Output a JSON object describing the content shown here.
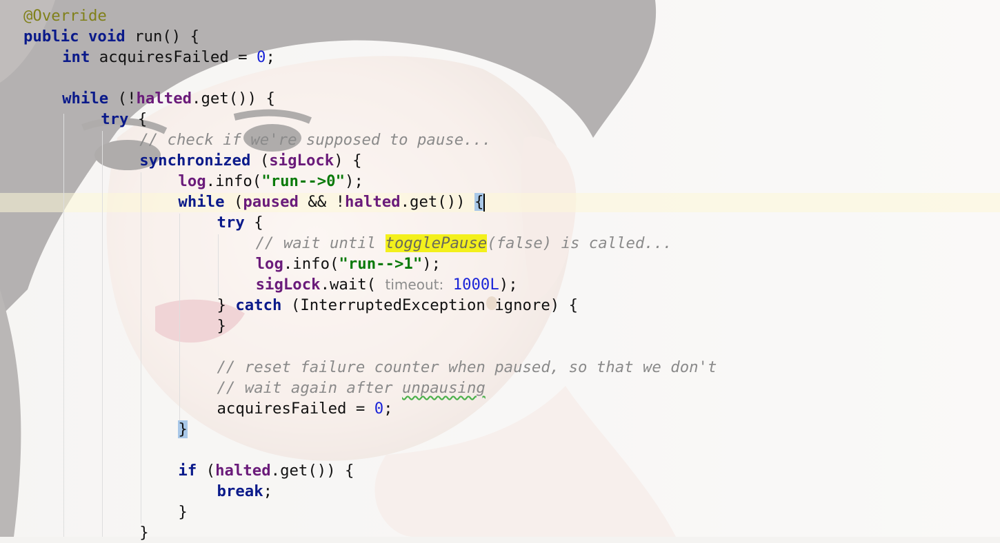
{
  "editor": {
    "lines": [
      {
        "indent": 0,
        "tokens": [
          {
            "t": "@Override",
            "c": "ann"
          }
        ]
      },
      {
        "indent": 0,
        "tokens": [
          {
            "t": "public",
            "c": "kw"
          },
          {
            "t": " "
          },
          {
            "t": "void",
            "c": "kw"
          },
          {
            "t": " run() {"
          }
        ]
      },
      {
        "indent": 1,
        "tokens": [
          {
            "t": "int",
            "c": "kw"
          },
          {
            "t": " acquiresFailed = "
          },
          {
            "t": "0",
            "c": "num"
          },
          {
            "t": ";"
          }
        ]
      },
      {
        "indent": 0,
        "tokens": []
      },
      {
        "indent": 1,
        "tokens": [
          {
            "t": "while",
            "c": "kw"
          },
          {
            "t": " (!"
          },
          {
            "t": "halted",
            "c": "fld"
          },
          {
            "t": ".get()) {"
          }
        ]
      },
      {
        "indent": 2,
        "tokens": [
          {
            "t": "try",
            "c": "kw"
          },
          {
            "t": " {"
          }
        ]
      },
      {
        "indent": 3,
        "tokens": [
          {
            "t": "// check if we're supposed to pause...",
            "c": "com"
          }
        ]
      },
      {
        "indent": 3,
        "tokens": [
          {
            "t": "synchronized",
            "c": "kw"
          },
          {
            "t": " ("
          },
          {
            "t": "sigLock",
            "c": "fld"
          },
          {
            "t": ") {"
          }
        ]
      },
      {
        "indent": 4,
        "tokens": [
          {
            "t": "log",
            "c": "fld"
          },
          {
            "t": ".info("
          },
          {
            "t": "\"run-->0\"",
            "c": "str"
          },
          {
            "t": ");"
          }
        ]
      },
      {
        "indent": 4,
        "tokens": [
          {
            "t": "while",
            "c": "kw"
          },
          {
            "t": " ("
          },
          {
            "t": "paused",
            "c": "fld"
          },
          {
            "t": " && !"
          },
          {
            "t": "halted",
            "c": "fld"
          },
          {
            "t": ".get()) "
          },
          {
            "t": "{",
            "c": "brace-hl"
          },
          {
            "t": "",
            "c": "caret"
          }
        ]
      },
      {
        "indent": 5,
        "tokens": [
          {
            "t": "try",
            "c": "kw"
          },
          {
            "t": " {"
          }
        ]
      },
      {
        "indent": 6,
        "tokens": [
          {
            "t": "// wait until ",
            "c": "com"
          },
          {
            "t": "togglePause",
            "c": "hl"
          },
          {
            "t": "(false) is called...",
            "c": "com"
          }
        ]
      },
      {
        "indent": 6,
        "tokens": [
          {
            "t": "log",
            "c": "fld"
          },
          {
            "t": ".info("
          },
          {
            "t": "\"run-->1\"",
            "c": "str"
          },
          {
            "t": ");"
          }
        ]
      },
      {
        "indent": 6,
        "tokens": [
          {
            "t": "sigLock",
            "c": "fld"
          },
          {
            "t": ".wait( "
          },
          {
            "t": "timeout:",
            "c": "hint"
          },
          {
            "t": " "
          },
          {
            "t": "1000L",
            "c": "num"
          },
          {
            "t": ");"
          }
        ]
      },
      {
        "indent": 5,
        "tokens": [
          {
            "t": "} "
          },
          {
            "t": "catch",
            "c": "kw"
          },
          {
            "t": " (InterruptedException ignore) {"
          }
        ]
      },
      {
        "indent": 5,
        "tokens": [
          {
            "t": "}"
          }
        ]
      },
      {
        "indent": 0,
        "tokens": []
      },
      {
        "indent": 5,
        "tokens": [
          {
            "t": "// reset failure counter when paused, so that we don't",
            "c": "com"
          }
        ]
      },
      {
        "indent": 5,
        "tokens": [
          {
            "t": "// wait again after ",
            "c": "com"
          },
          {
            "t": "unpausing",
            "c": "com sq"
          }
        ]
      },
      {
        "indent": 5,
        "tokens": [
          {
            "t": "acquiresFailed = "
          },
          {
            "t": "0",
            "c": "num"
          },
          {
            "t": ";"
          }
        ]
      },
      {
        "indent": 4,
        "tokens": [
          {
            "t": "}",
            "c": "brace-hl"
          }
        ]
      },
      {
        "indent": 0,
        "tokens": []
      },
      {
        "indent": 4,
        "tokens": [
          {
            "t": "if",
            "c": "kw"
          },
          {
            "t": " ("
          },
          {
            "t": "halted",
            "c": "fld"
          },
          {
            "t": ".get()) {"
          }
        ]
      },
      {
        "indent": 5,
        "tokens": [
          {
            "t": "break",
            "c": "kw"
          },
          {
            "t": ";"
          }
        ]
      },
      {
        "indent": 4,
        "tokens": [
          {
            "t": "}"
          }
        ]
      },
      {
        "indent": 3,
        "tokens": [
          {
            "t": "}"
          }
        ]
      }
    ]
  }
}
